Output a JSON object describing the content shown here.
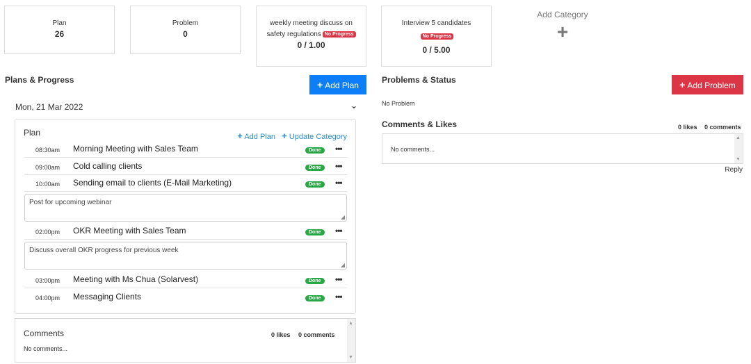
{
  "stats": [
    {
      "label": "Plan",
      "value": "26",
      "badge": ""
    },
    {
      "label": "Problem",
      "value": "0",
      "badge": ""
    },
    {
      "label_line1": "weekly meeting discuss on",
      "label_line2": "safety regulations",
      "badge": "No Progress",
      "value": "0 / 1.00"
    },
    {
      "label": "Interview 5 candidates",
      "badge": "No Progress",
      "value": "0 / 5.00"
    }
  ],
  "add_category": {
    "label": "Add Category",
    "icon": "plus-icon"
  },
  "plans_section": {
    "title": "Plans & Progress",
    "add_button": "Add Plan",
    "date": "Mon, 21 Mar 2022",
    "plan_heading": "Plan",
    "add_plan_link": "Add Plan",
    "update_category_link": "Update Category",
    "items": [
      {
        "time": "08:30am",
        "title": "Morning Meeting with Sales Team",
        "status": "Done"
      },
      {
        "time": "09:00am",
        "title": "Cold calling clients",
        "status": "Done"
      },
      {
        "time": "10:00am",
        "title": "Sending email to clients (E-Mail Marketing)",
        "status": "Done",
        "note": "Post for upcoming webinar"
      },
      {
        "time": "02:00pm",
        "title": "OKR Meeting with Sales Team",
        "status": "Done",
        "note": "Discuss overall OKR progress for previous week"
      },
      {
        "time": "03:00pm",
        "title": "Meeting with Ms Chua (Solarvest)",
        "status": "Done"
      },
      {
        "time": "04:00pm",
        "title": "Messaging Clients",
        "status": "Done"
      }
    ],
    "comments": {
      "title": "Comments",
      "likes": "0 likes",
      "count": "0 comments",
      "empty": "No comments..."
    }
  },
  "problems_section": {
    "title": "Problems & Status",
    "add_button": "Add Problem",
    "empty": "No Problem",
    "comments_title": "Comments & Likes",
    "likes": "0 likes",
    "count": "0 comments",
    "empty_comments": "No comments...",
    "reply": "Reply"
  },
  "colors": {
    "primary": "#0d7ef7",
    "danger": "#dc3545",
    "success": "#28a745",
    "link": "#2b8ec9"
  }
}
